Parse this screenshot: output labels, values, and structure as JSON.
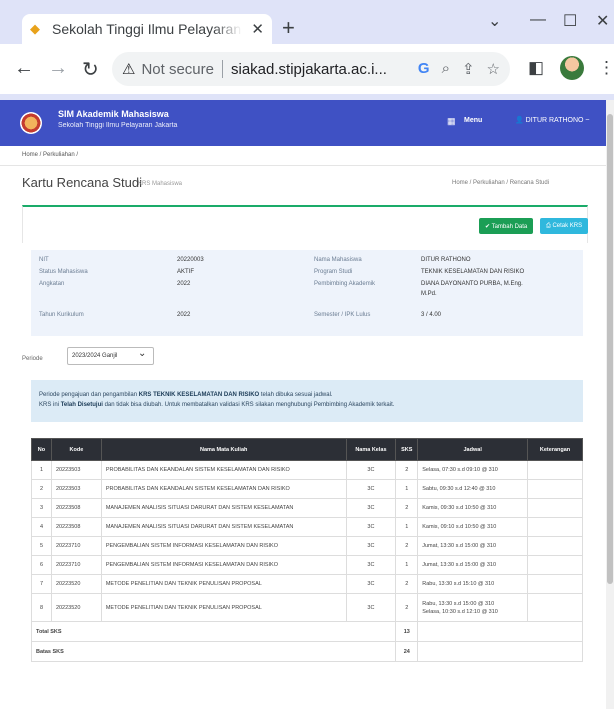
{
  "browser": {
    "tab_title": "Sekolah Tinggi Ilmu Pelayaran Ja",
    "tab_close": "✕",
    "new_tab": "+",
    "not_secure": "Not secure",
    "url": "siakad.stipjakarta.ac.i..."
  },
  "header": {
    "app_name": "SIM Akademik Mahasiswa",
    "app_subtitle": "Sekolah Tinggi Ilmu Pelayaran Jakarta",
    "menu_label": "Menu",
    "user_label": "DITUR RATHONO ~"
  },
  "breadcrumb": "Home  /  Perkuliahan  /",
  "page": {
    "title": "Kartu Rencana Studi",
    "subtitle": "KRS Mahasiswa",
    "crumbs": "Home  /  Perkuliahan  /  Rencana Studi"
  },
  "actions": {
    "primary": "✔ Tambah Data",
    "secondary": "⎙ Cetak KRS"
  },
  "info": {
    "left": [
      {
        "label": "NIT",
        "value": "20220003"
      },
      {
        "label": "Status Mahasiswa",
        "value": "AKTIF"
      },
      {
        "label": "Angkatan",
        "value": "2022"
      },
      {
        "label": "Tahun Kurikulum",
        "value": "2022"
      }
    ],
    "right": [
      {
        "label": "Nama Mahasiswa",
        "value": "DITUR RATHONO"
      },
      {
        "label": "Program Studi",
        "value": "TEKNIK KESELAMATAN DAN RISIKO"
      },
      {
        "label": "Pembimbing Akademik",
        "value": "DIANA DAYONANTO PURBA, M.Eng."
      },
      {
        "label": "",
        "value": "M.Pd."
      },
      {
        "label": "Semester / IPK Lulus",
        "value": "3 / 4.00"
      }
    ]
  },
  "filter": {
    "label": "Periode",
    "selected": "2023/2024 Ganjil"
  },
  "notice": {
    "line1_pre": "Periode pengajuan dan pengambilan",
    "line1_bold": "KRS TEKNIK KESELAMATAN DAN RISIKO",
    "line1_post": "telah dibuka sesuai jadwal.",
    "line2_pre": "KRS ini",
    "line2_bold": "Telah Disetujui",
    "line2_post": "dan tidak bisa diubah. Untuk membatalkan validasi KRS silakan menghubungi Pembimbing Akademik terkait."
  },
  "table": {
    "columns": [
      "No",
      "Kode",
      "Nama Mata Kuliah",
      "Nama Kelas",
      "SKS",
      "Jadwal",
      "Keterangan"
    ],
    "rows": [
      {
        "no": "1",
        "kode": "20223503",
        "nama": "PROBABILITAS DAN KEANDALAN SISTEM KESELAMATAN DAN RISIKO",
        "kelas": "3C",
        "sks": "2",
        "jadwal": [
          "Selasa, 07:30 s.d 09:10 @ 310"
        ],
        "ket": ""
      },
      {
        "no": "2",
        "kode": "20223503",
        "nama": "PROBABILITAS DAN KEANDALAN SISTEM KESELAMATAN DAN RISIKO",
        "kelas": "3C",
        "sks": "1",
        "jadwal": [
          "Sabtu, 09:30 s.d 12:40 @ 310"
        ],
        "ket": ""
      },
      {
        "no": "3",
        "kode": "20223508",
        "nama": "MANAJEMEN ANALISIS SITUASI DARURAT DAN SISTEM KESELAMATAN",
        "kelas": "3C",
        "sks": "2",
        "jadwal": [
          "Kamis, 09:30 s.d 10:50 @ 310"
        ],
        "ket": ""
      },
      {
        "no": "4",
        "kode": "20223508",
        "nama": "MANAJEMEN ANALISIS SITUASI DARURAT DAN SISTEM KESELAMATAN",
        "kelas": "3C",
        "sks": "1",
        "jadwal": [
          "Kamis, 09:10 s.d 10:50 @ 310"
        ],
        "ket": ""
      },
      {
        "no": "5",
        "kode": "20223710",
        "nama": "PENGEMBALIAN SISTEM INFORMASI KESELAMATAN DAN RISIKO",
        "kelas": "3C",
        "sks": "2",
        "jadwal": [
          "Jumat, 13:30 s.d 15:00 @ 310"
        ],
        "ket": ""
      },
      {
        "no": "6",
        "kode": "20223710",
        "nama": "PENGEMBALIAN SISTEM INFORMASI KESELAMATAN DAN RISIKO",
        "kelas": "3C",
        "sks": "1",
        "jadwal": [
          "Jumat, 13:30 s.d 15:00 @ 310"
        ],
        "ket": ""
      },
      {
        "no": "7",
        "kode": "20223520",
        "nama": "METODE PENELITIAN DAN TEKNIK PENULISAN PROPOSAL",
        "kelas": "3C",
        "sks": "2",
        "jadwal": [
          "Rabu, 13:30 s.d 15:10 @ 310"
        ],
        "ket": ""
      },
      {
        "no": "8",
        "kode": "20223520",
        "nama": "METODE PENELITIAN DAN TEKNIK PENULISAN PROPOSAL",
        "kelas": "3C",
        "sks": "2",
        "jadwal": [
          "Rabu, 13:30 s.d 15:00 @ 310",
          "Selasa, 10:30 s.d 12:10 @ 310"
        ],
        "ket": ""
      }
    ],
    "total_label": "Total SKS",
    "total_value": "13",
    "limit_label": "Batas SKS",
    "limit_value": "24"
  }
}
